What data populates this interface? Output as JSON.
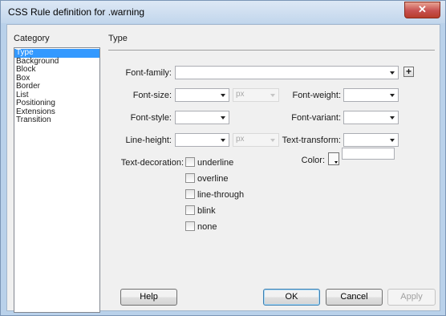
{
  "window": {
    "title": "CSS Rule definition for .warning",
    "close_glyph": "✕"
  },
  "category": {
    "header": "Category",
    "items": [
      "Type",
      "Background",
      "Block",
      "Box",
      "Border",
      "List",
      "Positioning",
      "Extensions",
      "Transition"
    ],
    "selected": "Type"
  },
  "panel": {
    "header": "Type",
    "font_family_label": "Font-family:",
    "font_size_label": "Font-size:",
    "font_weight_label": "Font-weight:",
    "font_style_label": "Font-style:",
    "font_variant_label": "Font-variant:",
    "line_height_label": "Line-height:",
    "text_transform_label": "Text-transform:",
    "text_decoration_label": "Text-decoration:",
    "color_label": "Color:",
    "font_size_unit": "px",
    "line_height_unit": "px",
    "plus_glyph": "+",
    "decorations": [
      {
        "label": "underline",
        "checked": false
      },
      {
        "label": "overline",
        "checked": false
      },
      {
        "label": "line-through",
        "checked": false
      },
      {
        "label": "blink",
        "checked": false
      },
      {
        "label": "none",
        "checked": false
      }
    ]
  },
  "buttons": {
    "help": "Help",
    "ok": "OK",
    "cancel": "Cancel",
    "apply": "Apply"
  }
}
